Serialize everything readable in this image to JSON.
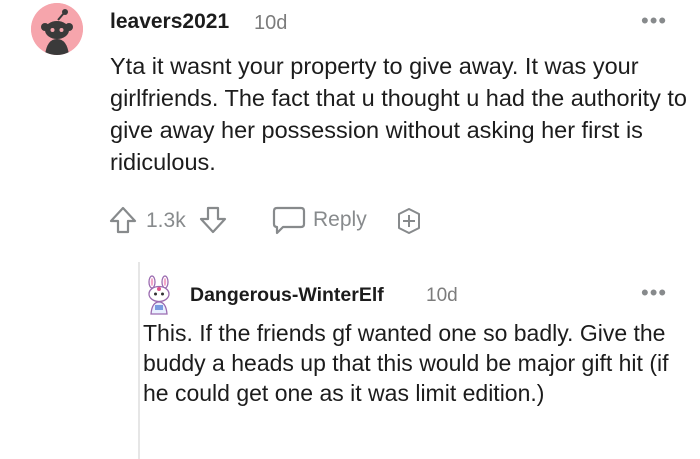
{
  "comment": {
    "username": "leavers2021",
    "age": "10d",
    "body": "Yta it wasnt your property to give away. It was your girlfriends. The fact that u thought u had the authority to give away her possession without asking her first is ridiculous.",
    "votes": "1.3k",
    "reply_label": "Reply"
  },
  "reply": {
    "username": "Dangerous-WinterElf",
    "age": "10d",
    "body": "This. If the friends gf wanted one so badly. Give the buddy a heads up that this would be major gift hit (if he could get one as it was limit edition.)"
  },
  "colors": {
    "avatar_bg": "#f6a5ac",
    "meta_gray": "#7c7c7c",
    "icon_gray": "#878a8c",
    "text": "#1c1c1c"
  },
  "icons": [
    "snoo-avatar-icon",
    "more-options-icon",
    "upvote-icon",
    "downvote-icon",
    "reply-bubble-icon",
    "award-add-icon",
    "snoo-bunny-avatar-icon"
  ]
}
